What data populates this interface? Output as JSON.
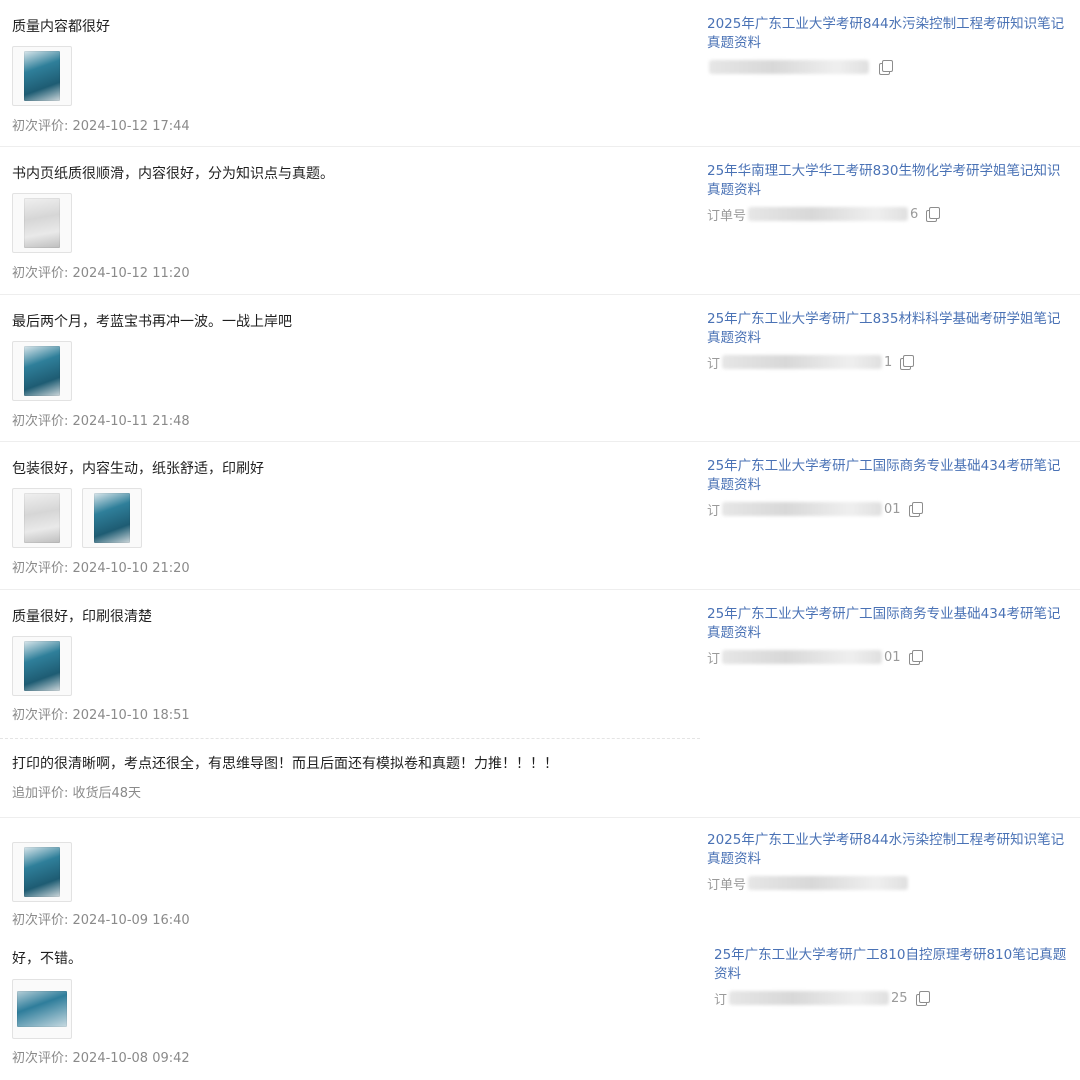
{
  "reviews": [
    {
      "text": "质量内容都很好",
      "thumbs": [
        "blue-cover"
      ],
      "time": "初次评价: 2024-10-12 17:44",
      "product_title": "2025年广东工业大学考研844水污染控制工程考研知识笔记真题资料",
      "order_label": "",
      "order_tail": ""
    },
    {
      "text": "书内页纸质很顺滑，内容很好，分为知识点与真题。",
      "thumbs": [
        "gray-page"
      ],
      "time": "初次评价: 2024-10-12 11:20",
      "product_title": "25年华南理工大学华工考研830生物化学考研学姐笔记知识真题资料",
      "order_label": "订单号",
      "order_tail": "6"
    },
    {
      "text": "最后两个月，考蓝宝书再冲一波。一战上岸吧",
      "thumbs": [
        "blue-cover"
      ],
      "time": "初次评价: 2024-10-11 21:48",
      "product_title": "25年广东工业大学考研广工835材料科学基础考研学姐笔记真题资料",
      "order_label": "订",
      "order_tail": "1"
    },
    {
      "text": "包装很好，内容生动，纸张舒适，印刷好",
      "thumbs": [
        "gray-page",
        "blue-cover"
      ],
      "time": "初次评价: 2024-10-10 21:20",
      "product_title": "25年广东工业大学考研广工国际商务专业基础434考研笔记真题资料",
      "order_label": "订",
      "order_tail": "01"
    },
    {
      "text": "质量很好，印刷很清楚",
      "thumbs": [
        "blue-cover"
      ],
      "time": "初次评价: 2024-10-10 18:51",
      "product_title": "25年广东工业大学考研广工国际商务专业基础434考研笔记真题资料",
      "order_label": "订",
      "order_tail": "01"
    },
    {
      "text": "",
      "thumbs": [
        "blue-cover"
      ],
      "time": "初次评价: 2024-10-09 16:40",
      "product_title": "2025年广东工业大学考研844水污染控制工程考研知识笔记真题资料",
      "order_label": "订单号",
      "order_tail": ""
    },
    {
      "text": "好，不错。",
      "thumbs": [
        "wide-cover"
      ],
      "time": "初次评价: 2024-10-08 09:42",
      "product_title": "25年广东工业大学考研广工810自控原理考研810笔记真题资料",
      "order_label": "订",
      "order_tail": "25"
    }
  ],
  "followup": {
    "text": "打印的很清晰啊，考点还很全，有思维导图！而且后面还有模拟卷和真题！力推！！！！",
    "time": "追加评价: 收货后48天"
  },
  "colors": {
    "link": "#4a72b5",
    "meta": "#8a8a8a"
  },
  "icons": {
    "copy": "copy-icon"
  }
}
